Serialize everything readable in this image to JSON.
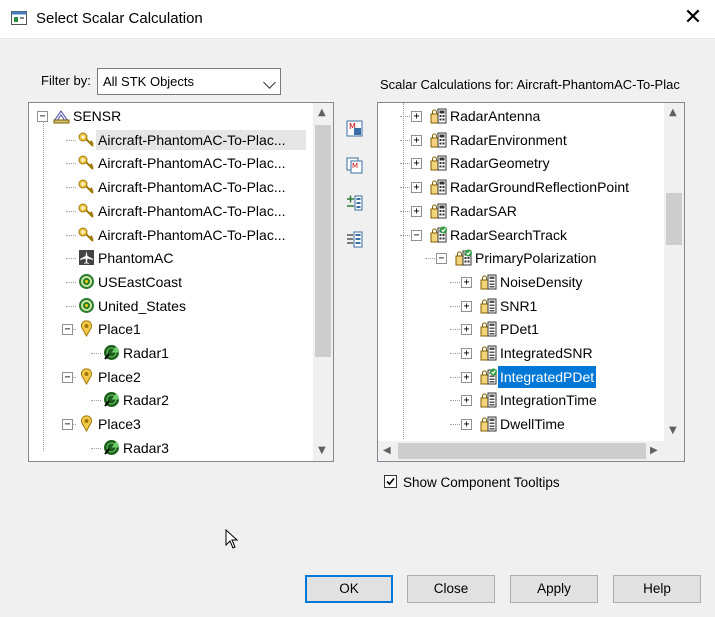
{
  "window": {
    "title": "Select Scalar Calculation",
    "close_glyph": "✕"
  },
  "filter": {
    "label": "Filter by:",
    "value": "All STK Objects"
  },
  "right_header": "Scalar Calculations for: Aircraft-PhantomAC-To-Plac",
  "left_tree": [
    {
      "label": "SENSR",
      "icon": "sensor-icon",
      "toggle": "−"
    },
    {
      "label": "Aircraft-PhantomAC-To-Plac...",
      "icon": "key-icon"
    },
    {
      "label": "Aircraft-PhantomAC-To-Plac...",
      "icon": "key-icon"
    },
    {
      "label": "Aircraft-PhantomAC-To-Plac...",
      "icon": "key-icon"
    },
    {
      "label": "Aircraft-PhantomAC-To-Plac...",
      "icon": "key-icon"
    },
    {
      "label": "Aircraft-PhantomAC-To-Plac...",
      "icon": "key-icon"
    },
    {
      "label": "PhantomAC",
      "icon": "aircraft-icon"
    },
    {
      "label": "USEastCoast",
      "icon": "area-target-icon"
    },
    {
      "label": "United_States",
      "icon": "area-target-icon"
    },
    {
      "label": "Place1",
      "icon": "place-icon",
      "toggle": "−"
    },
    {
      "label": "Radar1",
      "icon": "radar-icon"
    },
    {
      "label": "Place2",
      "icon": "place-icon",
      "toggle": "−"
    },
    {
      "label": "Radar2",
      "icon": "radar-icon"
    },
    {
      "label": "Place3",
      "icon": "place-icon",
      "toggle": "−"
    },
    {
      "label": "Radar3",
      "icon": "radar-icon"
    }
  ],
  "right_tree": [
    {
      "label": "RadarAntenna",
      "icon": "calc-folder-icon",
      "toggle": "+"
    },
    {
      "label": "RadarEnvironment",
      "icon": "calc-folder-icon",
      "toggle": "+"
    },
    {
      "label": "RadarGeometry",
      "icon": "calc-folder-icon",
      "toggle": "+"
    },
    {
      "label": "RadarGroundReflectionPoint",
      "icon": "calc-folder-icon",
      "toggle": "+"
    },
    {
      "label": "RadarSAR",
      "icon": "calc-folder-icon",
      "toggle": "+"
    },
    {
      "label": "RadarSearchTrack",
      "icon": "calc-folder-check-icon",
      "toggle": "−"
    },
    {
      "label": "PrimaryPolarization",
      "icon": "calc-folder-check-icon",
      "toggle": "−"
    },
    {
      "label": "NoiseDensity",
      "icon": "calc-item-icon",
      "toggle": "+"
    },
    {
      "label": "SNR1",
      "icon": "calc-item-icon",
      "toggle": "+"
    },
    {
      "label": "PDet1",
      "icon": "calc-item-icon",
      "toggle": "+"
    },
    {
      "label": "IntegratedSNR",
      "icon": "calc-item-icon",
      "toggle": "+"
    },
    {
      "label": "IntegratedPDet",
      "icon": "calc-item-check-icon",
      "toggle": "+",
      "selected": true
    },
    {
      "label": "IntegrationTime",
      "icon": "calc-item-icon",
      "toggle": "+"
    },
    {
      "label": "DwellTime",
      "icon": "calc-item-icon",
      "toggle": "+"
    }
  ],
  "middle_buttons": [
    "new-calc-icon",
    "duplicate-calc-icon",
    "edit-calc-icon",
    "insert-calc-icon"
  ],
  "tooltips": {
    "label": "Show Component Tooltips",
    "checked": true
  },
  "buttons": {
    "ok": "OK",
    "close": "Close",
    "apply": "Apply",
    "help": "Help"
  },
  "colors": {
    "selection": "#0078d7",
    "accent_border": "#0078d7"
  }
}
